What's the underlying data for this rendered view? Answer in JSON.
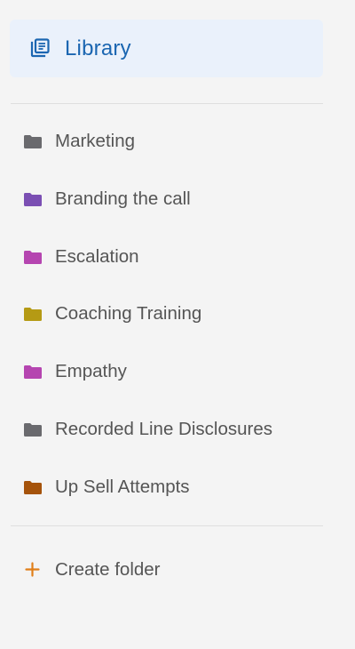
{
  "library": {
    "label": "Library",
    "icon": "library-books-icon",
    "accent_color": "#1b66b1",
    "background_color": "#eaf1fb"
  },
  "folders": [
    {
      "label": "Marketing",
      "icon": "folder-icon",
      "color": "#6a6a6e"
    },
    {
      "label": "Branding the call",
      "icon": "folder-icon",
      "color": "#7b4fb3"
    },
    {
      "label": "Escalation",
      "icon": "folder-icon",
      "color": "#b545b0"
    },
    {
      "label": "Coaching Training",
      "icon": "folder-icon",
      "color": "#b59a14"
    },
    {
      "label": "Empathy",
      "icon": "folder-icon",
      "color": "#b545b0"
    },
    {
      "label": "Recorded Line Disclosures",
      "icon": "folder-icon",
      "color": "#6a6a6e"
    },
    {
      "label": "Up Sell Attempts",
      "icon": "folder-icon",
      "color": "#a5530b"
    }
  ],
  "create_folder": {
    "label": "Create folder",
    "icon": "plus-icon",
    "icon_color": "#e07e18"
  }
}
